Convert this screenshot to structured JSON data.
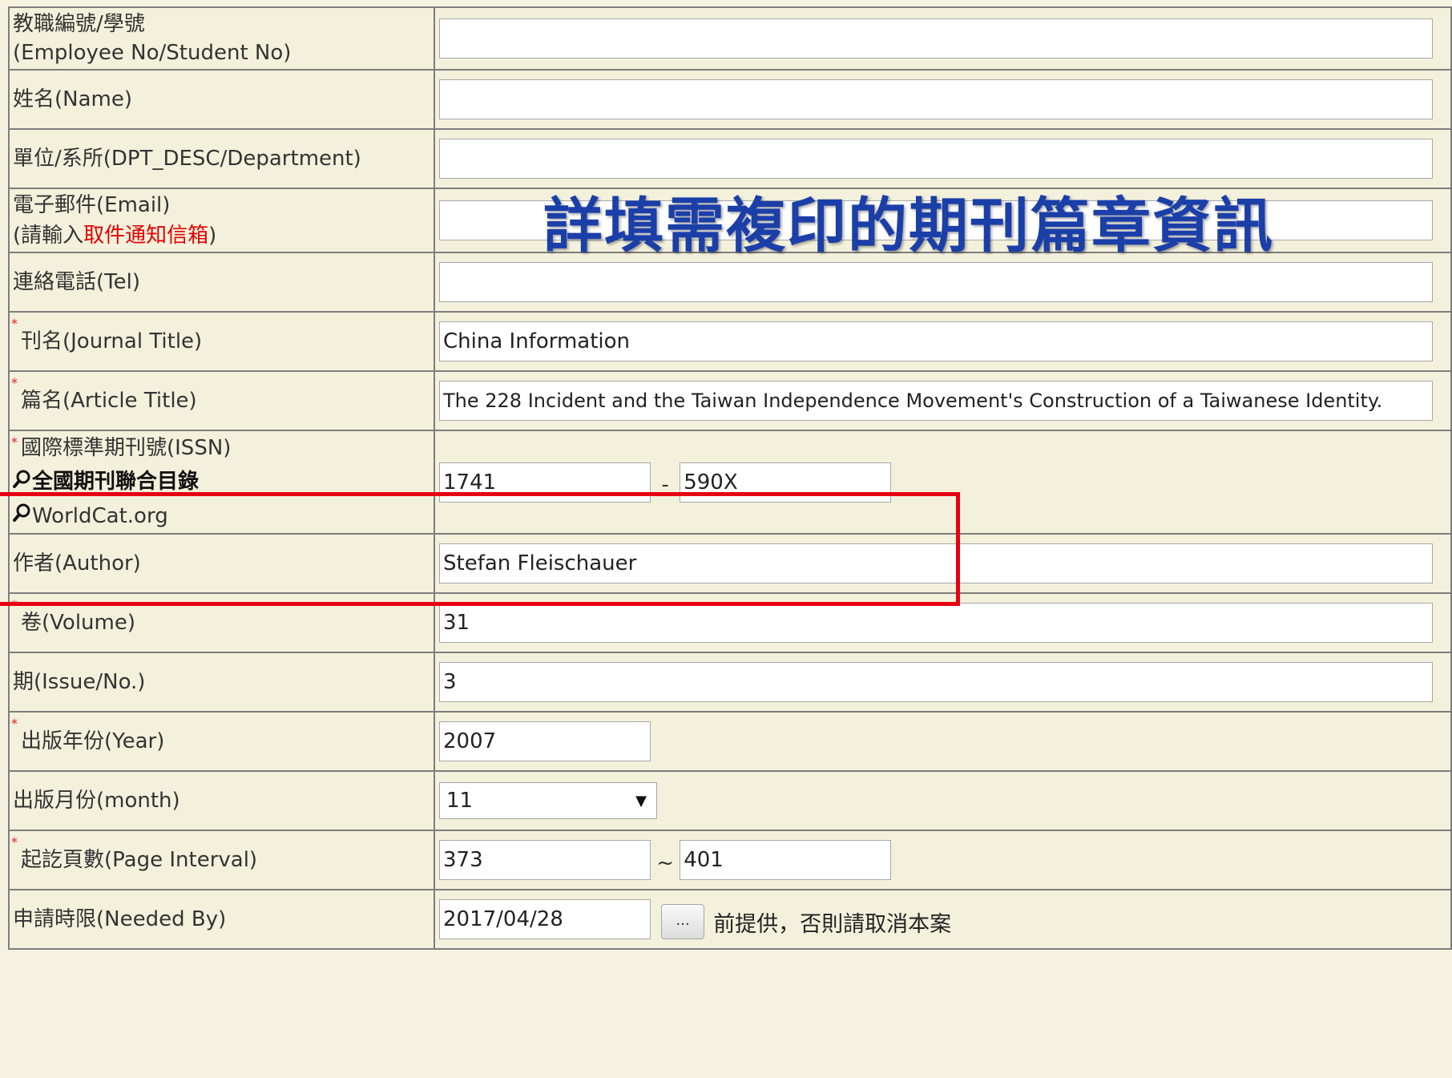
{
  "fields": {
    "employee_no": {
      "label": "教職編號/學號",
      "label_sub": "(Employee No/Student No)",
      "value": ""
    },
    "name": {
      "label": "姓名(Name)",
      "value": ""
    },
    "department": {
      "label": "單位/系所(DPT_DESC/Department)",
      "value": ""
    },
    "email": {
      "label": "電子郵件(Email)",
      "label_sub_prefix": "(請輸入",
      "label_sub_highlight": "取件通知信箱",
      "label_sub_suffix": ")",
      "value": ""
    },
    "tel": {
      "label": "連絡電話(Tel)",
      "value": ""
    },
    "journal_title": {
      "required_mark": "*",
      "label": "刊名(Journal Title)",
      "value": "China Information"
    },
    "article_title": {
      "required_mark": "*",
      "label": "篇名(Article Title)",
      "value": "The 228 Incident and the Taiwan Independence Movement's Construction of a Taiwanese Identity."
    },
    "issn": {
      "required_mark": "*",
      "label": "國際標準期刊號(ISSN)",
      "link1": "全國期刊聯合目錄",
      "link2": "WorldCat.org",
      "value1": "1741",
      "separator": "-",
      "value2": "590X"
    },
    "author": {
      "label": "作者(Author)",
      "value": "Stefan Fleischauer"
    },
    "volume": {
      "required_mark": "*",
      "label": "卷(Volume)",
      "value": "31"
    },
    "issue": {
      "label": "期(Issue/No.)",
      "value": "3"
    },
    "year": {
      "required_mark": "*",
      "label": "出版年份(Year)",
      "value": "2007"
    },
    "month": {
      "label": "出版月份(month)",
      "selected": "11",
      "arrow": "▼"
    },
    "pages": {
      "required_mark": "*",
      "label": "起訖頁數(Page Interval)",
      "from": "373",
      "separator": "~",
      "to": "401"
    },
    "needed_by": {
      "label": "申請時限(Needed By)",
      "value": "2017/04/28",
      "button_label": "...",
      "note": "前提供，否則請取消本案"
    }
  },
  "overlay_title": "詳填需複印的期刊篇章資訊",
  "icons": {
    "search": "magnifier-icon"
  },
  "colors": {
    "overlay_title": "#1b3fa8",
    "highlight_box": "#e60012",
    "required": "#e02020"
  }
}
